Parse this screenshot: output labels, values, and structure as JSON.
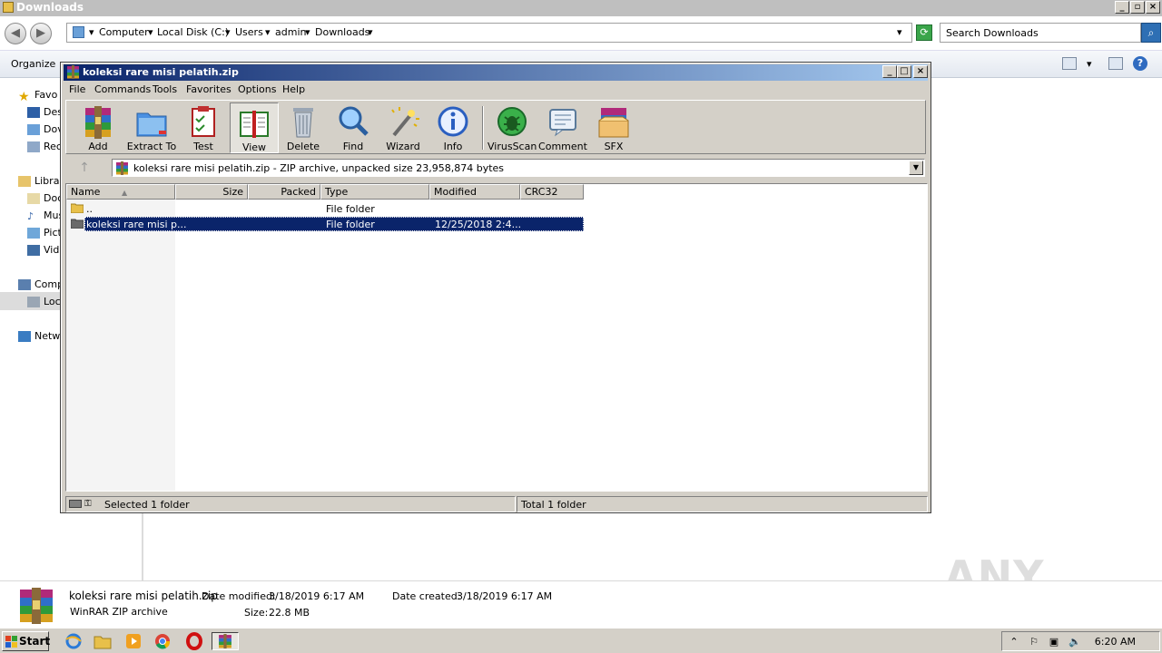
{
  "explorer": {
    "title": "Downloads",
    "breadcrumb": [
      "Computer",
      "Local Disk (C:)",
      "Users",
      "admin",
      "Downloads"
    ],
    "search_placeholder": "Search Downloads",
    "organize_label": "Organize",
    "nav": {
      "favorites": "Favo",
      "desktop": "Des",
      "downloads": "Dov",
      "recent": "Rec",
      "libraries": "Librar",
      "documents": "Doc",
      "music": "Mus",
      "pictures": "Pict",
      "videos": "Vide",
      "computer": "Comp",
      "local_disk": "Loc",
      "network": "Netw"
    },
    "details": {
      "filename": "koleksi rare misi pelatih.zip",
      "type": "WinRAR ZIP archive",
      "date_modified_label": "Date modified:",
      "date_modified": "3/18/2019 6:17 AM",
      "date_created_label": "Date created:",
      "date_created": "3/18/2019 6:17 AM",
      "size_label": "Size:",
      "size": "22.8 MB"
    },
    "watermark": "ANY RUN"
  },
  "rar": {
    "title": "koleksi rare misi pelatih.zip",
    "menu": [
      "File",
      "Commands",
      "Tools",
      "Favorites",
      "Options",
      "Help"
    ],
    "toolbar": [
      "Add",
      "Extract To",
      "Test",
      "View",
      "Delete",
      "Find",
      "Wizard",
      "Info",
      "VirusScan",
      "Comment",
      "SFX"
    ],
    "path": "koleksi rare misi pelatih.zip - ZIP archive, unpacked size 23,958,874 bytes",
    "columns": [
      "Name",
      "Size",
      "Packed",
      "Type",
      "Modified",
      "CRC32"
    ],
    "rows": [
      {
        "name": "..",
        "size": "",
        "packed": "",
        "type": "File folder",
        "modified": "",
        "crc": ""
      },
      {
        "name": "koleksi rare misi p...",
        "size": "",
        "packed": "",
        "type": "File folder",
        "modified": "12/25/2018 2:4...",
        "crc": ""
      }
    ],
    "status_left": "Selected 1 folder",
    "status_right": "Total 1 folder"
  },
  "taskbar": {
    "start_label": "Start",
    "clock": "6:20 AM"
  },
  "colors": {
    "title_active": "#0a246a",
    "selection": "#0a246a",
    "face": "#d4d0c8"
  }
}
